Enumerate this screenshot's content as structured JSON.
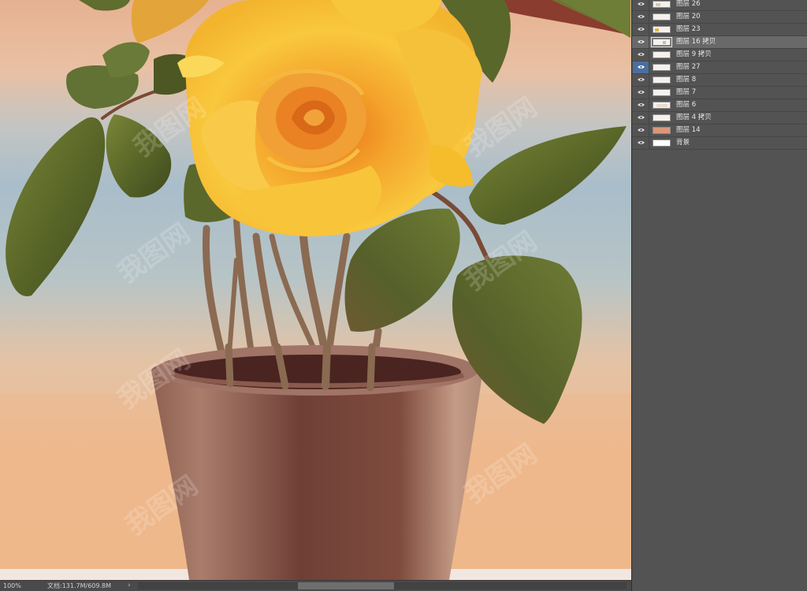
{
  "layers_panel": {
    "layers": [
      {
        "name": "图层 26",
        "thumb": "light"
      },
      {
        "name": "图层 20",
        "thumb": "light"
      },
      {
        "name": "图层 23",
        "thumb": "light"
      },
      {
        "name": "图层 16 拷贝",
        "thumb": "light",
        "selected": true
      },
      {
        "name": "图层 9 拷贝",
        "thumb": "light"
      },
      {
        "name": "图层 27",
        "thumb": "light",
        "eye_highlight": true
      },
      {
        "name": "图层 8",
        "thumb": "light"
      },
      {
        "name": "图层 7",
        "thumb": "light"
      },
      {
        "name": "图层 6",
        "thumb": "light"
      },
      {
        "name": "图层 4 拷贝",
        "thumb": "light"
      },
      {
        "name": "图层 14",
        "thumb": "peach"
      },
      {
        "name": "背景",
        "thumb": "bg"
      }
    ],
    "eye_icon": "eye-icon",
    "highlight_color": "#4a6fa0"
  },
  "statusbar": {
    "zoom": "100%",
    "doc_info": "文档:131.7M/609.8M",
    "arrow": "›"
  },
  "canvas": {
    "watermark_text": "我图网",
    "colors": {
      "sky_top": "#e9b898",
      "sky_blue": "#aebfc9",
      "sky_bottom": "#efb689",
      "petal": "#f7c23b",
      "petal_dark": "#e68a1e",
      "leaf": "#5d6a2c",
      "pot": "#8a5a4c"
    }
  }
}
